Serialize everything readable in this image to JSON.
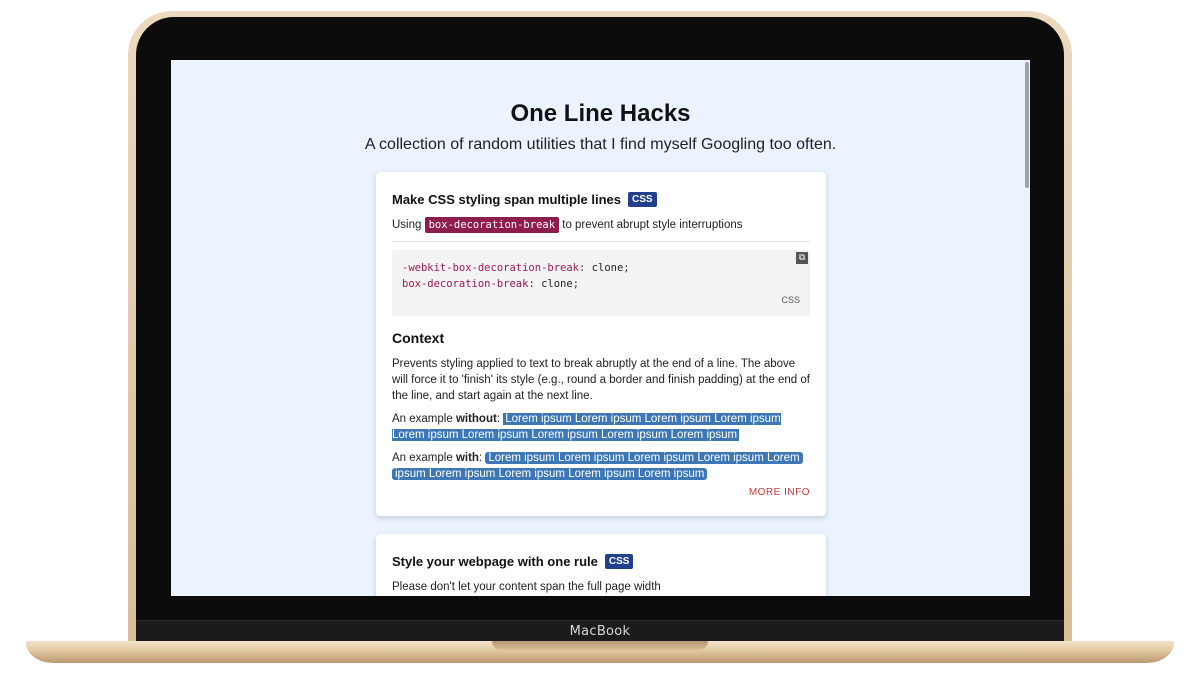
{
  "device": {
    "brand": "MacBook"
  },
  "page": {
    "title": "One Line Hacks",
    "subtitle": "A collection of random utilities that I find myself Googling too often."
  },
  "cards": [
    {
      "title": "Make CSS styling span multiple lines",
      "tag": "CSS",
      "desc_prefix": "Using",
      "desc_code": "box-decoration-break",
      "desc_suffix": "to prevent abrupt style interruptions",
      "code": [
        {
          "prop": "-webkit-box-decoration-break",
          "value": "clone"
        },
        {
          "prop": "box-decoration-break",
          "value": "clone"
        }
      ],
      "code_lang": "CSS",
      "context_title": "Context",
      "context_body": "Prevents styling applied to text to break abruptly at the end of a line. The above will force it to 'finish' its style (e.g., round a border and finish padding) at the end of the line, and start again at the next line.",
      "example_prefix": "An example",
      "example_without_label": "without",
      "example_with_label": "with",
      "example_text": "Lorem ipsum Lorem ipsum Lorem ipsum Lorem ipsum Lorem ipsum Lorem ipsum Lorem ipsum Lorem ipsum Lorem ipsum",
      "more_info": "MORE INFO"
    },
    {
      "title": "Style your webpage with one rule",
      "tag": "CSS",
      "desc": "Please don't let your content span the full page width"
    }
  ],
  "colors": {
    "screen_bg": "#eaf3ff",
    "tag_bg": "#23408e",
    "inline_code_bg": "#8e1c4f",
    "highlight": "#3d77b6",
    "link": "#c23a3a"
  }
}
